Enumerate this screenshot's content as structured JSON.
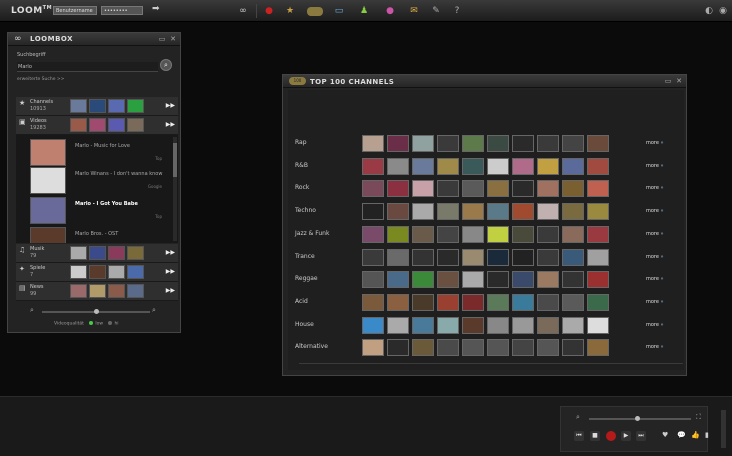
{
  "topbar": {
    "logo": "LOOM",
    "logo_tm": "TM",
    "username": "Benutzername",
    "password": "••••••••",
    "icons": [
      "infinity-icon",
      "record-icon",
      "star-icon",
      "top100-icon",
      "screen-icon",
      "users-icon",
      "chat-icon",
      "mail-icon",
      "settings-icon",
      "help-icon"
    ]
  },
  "loombox": {
    "title": "LOOMBOX",
    "search_label": "Suchbegriff",
    "search_value": "Marlo",
    "extended_search": "erweiterte Suche >>",
    "categories": [
      {
        "name": "Channels",
        "count": "10913"
      },
      {
        "name": "Videos",
        "count": "19283"
      },
      {
        "name": "Musik",
        "count": "79"
      },
      {
        "name": "Spiele",
        "count": "7"
      },
      {
        "name": "News",
        "count": "99"
      }
    ],
    "videos": [
      {
        "title": "Marlo - Music for Love",
        "tag": "Top"
      },
      {
        "title": "Marlo Winans - I don't wanna know",
        "tag": "Google"
      },
      {
        "title": "Marlo - I Got You Babe",
        "tag": "Top"
      },
      {
        "title": "Marlo Bros. - OST",
        "tag": ""
      }
    ],
    "quality_label": "Videoqualität",
    "quality_low": "low",
    "quality_high": "hi",
    "zoom_level": 0.5
  },
  "top100": {
    "title": "TOP 100 CHANNELS",
    "badge": "100",
    "genres": [
      "Rap",
      "R&B",
      "Rock",
      "Techno",
      "Jazz & Funk",
      "Trance",
      "Reggae",
      "Acid",
      "House",
      "Alternative"
    ],
    "more_label": "more",
    "more_chevron": "»",
    "thumb_colors": [
      [
        "#b8a090",
        "#6a2e48",
        "#8fa2a0",
        "#3a3a3a",
        "#5d7a4a",
        "#3c4a44",
        "#2a2a2a",
        "#3a3a3a",
        "#444",
        "#6a4a3a"
      ],
      [
        "#9a3a44",
        "#8a8a8a",
        "#6a7a9a",
        "#a08a4a",
        "#3a5a5a",
        "#ccc",
        "#b06a8a",
        "#c0a040",
        "#5a6a9a",
        "#a04a40"
      ],
      [
        "#7a4a5a",
        "#8a3040",
        "#c8a0a8",
        "#3a3a3a",
        "#5a5a5a",
        "#8a7040",
        "#2a2a2a",
        "#a07060",
        "#7a6030",
        "#c06050"
      ],
      [
        "#222",
        "#6a4a40",
        "#aaa",
        "#7a7a6a",
        "#9a7a4a",
        "#5a7a8a",
        "#a04a30",
        "#c0b0b0",
        "#7a6a40",
        "#9a8a40"
      ],
      [
        "#7a4a6a",
        "#7a8a20",
        "#6a5a4a",
        "#444",
        "#888",
        "#c0d040",
        "#4a4a3a",
        "#3a3a3a",
        "#8a6a5a",
        "#9a3a40"
      ],
      [
        "#3a3a3a",
        "#6a6a6a",
        "#333",
        "#2a2a2a",
        "#9a8a70",
        "#1a2a3a",
        "#222",
        "#3a3a3a",
        "#3a5a7a",
        "#a0a0a0"
      ],
      [
        "#555",
        "#4a6a8a",
        "#3a8a3a",
        "#6a5040",
        "#aaa",
        "#2a2a2a",
        "#3a4a6a",
        "#9a7a60",
        "#333",
        "#9a3030"
      ],
      [
        "#7a5a3a",
        "#8a6040",
        "#4a3a2a",
        "#9a4030",
        "#7a2a2a",
        "#5a7a5a",
        "#3a7a9a",
        "#4a4a4a",
        "#5a5a5a",
        "#3a6a4a"
      ],
      [
        "#3a8aca",
        "#aaa",
        "#4a7a9a",
        "#8aa",
        "#5a3a2a",
        "#888",
        "#999",
        "#7a6a5a",
        "#aaa",
        "#ddd"
      ],
      [
        "#c0a080",
        "#2a2a2a",
        "#6a5a3a",
        "#4a4a4a",
        "#555",
        "#555",
        "#444",
        "#555",
        "#333",
        "#8a6a3a"
      ]
    ]
  },
  "player": {
    "controls": [
      "prev-button",
      "stop-button",
      "record-button",
      "play-button",
      "next-button"
    ]
  }
}
